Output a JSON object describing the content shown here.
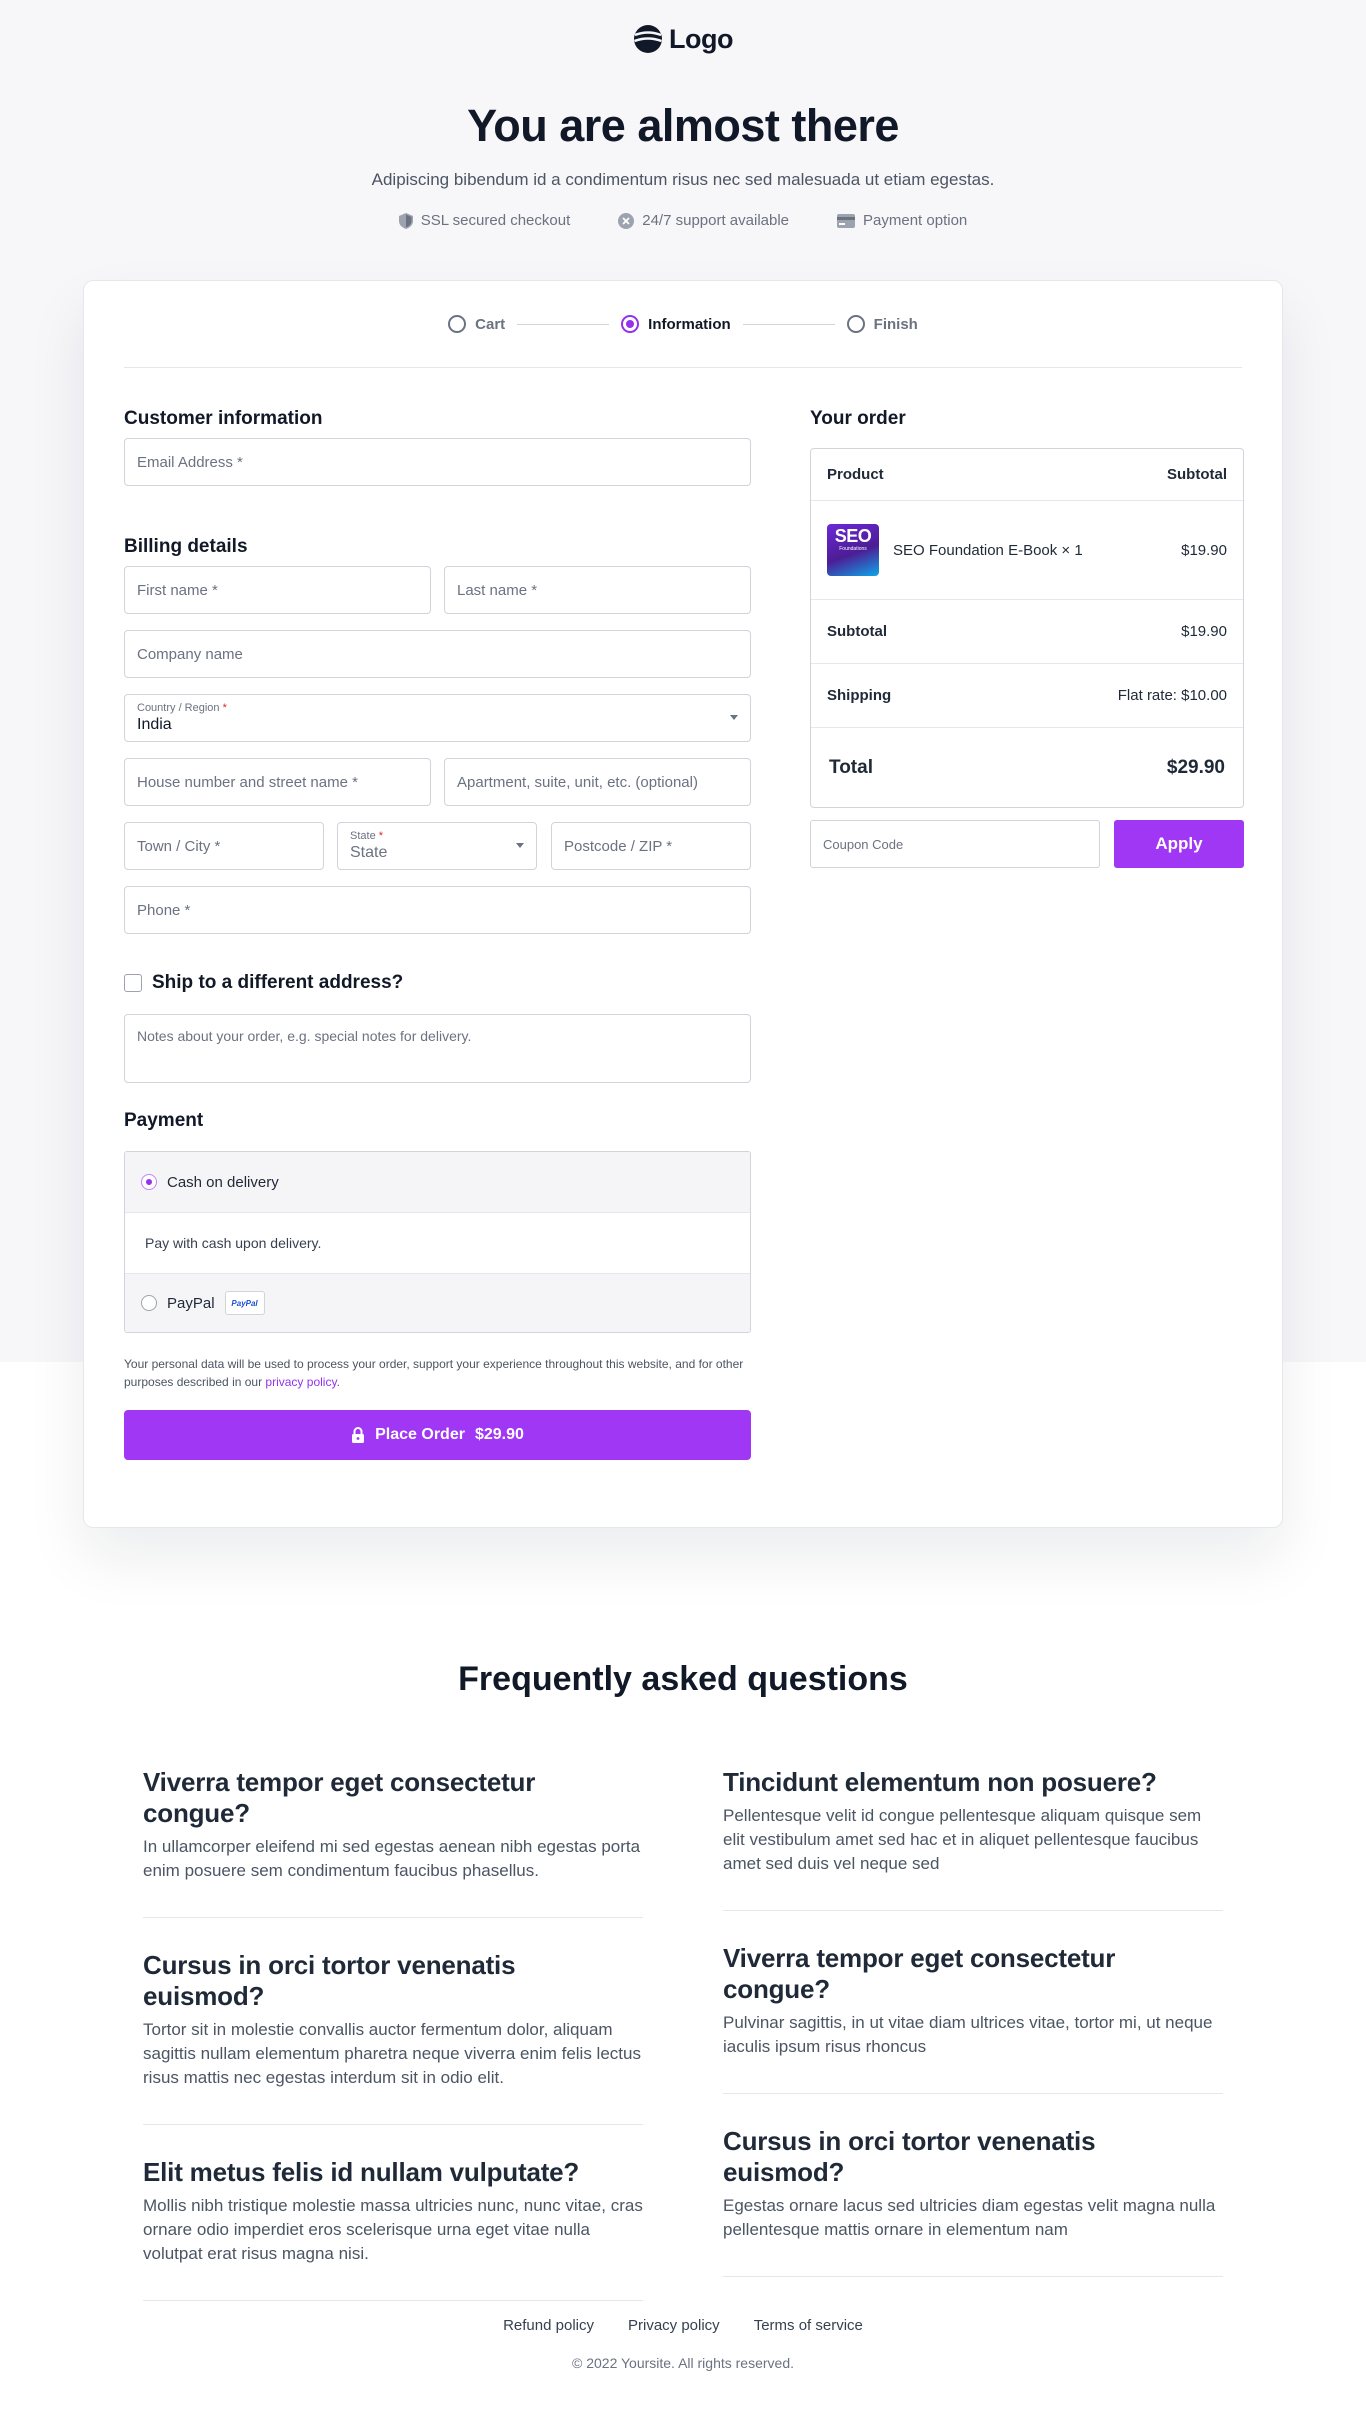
{
  "header": {
    "logo_text": "Logo",
    "title": "You are almost there",
    "subtitle": "Adipiscing bibendum id a condimentum risus nec sed malesuada ut etiam egestas.",
    "trust": [
      {
        "icon": "shield-icon",
        "label": "SSL secured checkout"
      },
      {
        "icon": "support-icon",
        "label": "24/7 support available"
      },
      {
        "icon": "credit-card-icon",
        "label": "Payment option"
      }
    ]
  },
  "steps": [
    {
      "label": "Cart",
      "active": false
    },
    {
      "label": "Information",
      "active": true
    },
    {
      "label": "Finish",
      "active": false
    }
  ],
  "customer": {
    "title": "Customer information",
    "email_placeholder": "Email Address *"
  },
  "billing": {
    "title": "Billing details",
    "first_name": "First name *",
    "last_name": "Last name *",
    "company": "Company name",
    "country_label": "Country / Region",
    "country_value": "India",
    "house": "House number and street name *",
    "apartment": "Apartment, suite, unit, etc. (optional)",
    "town": "Town / City *",
    "state_label": "State",
    "state_value": "State",
    "postcode": "Postcode / ZIP *",
    "phone": "Phone *",
    "required_mark": "*"
  },
  "ship_different": "Ship to a different address?",
  "notes_placeholder": "Notes about your order, e.g. special notes for delivery.",
  "payment": {
    "title": "Payment",
    "cod_label": "Cash on delivery",
    "cod_desc": "Pay with cash upon delivery.",
    "paypal_label": "PayPal",
    "paypal_badge": "PayPal"
  },
  "privacy": {
    "text": "Your personal data will be used to process your order, support your experience throughout this website, and for other purposes described in our ",
    "link": "privacy policy",
    "end": "."
  },
  "place_order": {
    "label": "Place Order",
    "amount": "$29.90"
  },
  "order": {
    "title": "Your order",
    "head_product": "Product",
    "head_subtotal": "Subtotal",
    "product_thumb_title": "SEO",
    "product_thumb_sub": "Foundations",
    "product_name": "SEO Foundation E-Book × 1",
    "product_price": "$19.90",
    "subtotal_label": "Subtotal",
    "subtotal_value": "$19.90",
    "shipping_label": "Shipping",
    "shipping_value": "Flat rate: $10.00",
    "total_label": "Total",
    "total_value": "$29.90",
    "coupon_placeholder": "Coupon Code",
    "apply_label": "Apply"
  },
  "faq": {
    "title": "Frequently asked questions",
    "left": [
      {
        "q": "Viverra tempor eget consectetur congue?",
        "a": "In ullamcorper eleifend mi sed egestas aenean nibh egestas porta enim posuere sem condimentum faucibus phasellus."
      },
      {
        "q": "Cursus in orci tortor venenatis euismod?",
        "a": "Tortor sit in molestie convallis auctor fermentum dolor, aliquam sagittis nullam elementum pharetra neque viverra enim felis lectus risus mattis nec egestas interdum sit in odio elit."
      },
      {
        "q": "Elit metus felis id nullam vulputate?",
        "a": "Mollis nibh tristique molestie massa ultricies nunc, nunc vitae, cras ornare odio imperdiet eros scelerisque urna eget vitae nulla volutpat erat risus magna nisi."
      }
    ],
    "right": [
      {
        "q": "Tincidunt elementum non posuere?",
        "a": "Pellentesque velit id congue pellentesque aliquam quisque sem elit vestibulum amet sed hac et in aliquet pellentesque faucibus amet sed duis vel neque sed"
      },
      {
        "q": "Viverra tempor eget consectetur congue?",
        "a": "Pulvinar sagittis, in ut vitae diam ultrices vitae, tortor mi, ut neque iaculis ipsum risus rhoncus"
      },
      {
        "q": "Cursus in orci tortor venenatis euismod?",
        "a": "Egestas ornare lacus sed ultricies diam egestas velit magna nulla pellentesque mattis ornare in elementum nam"
      }
    ]
  },
  "footer": {
    "links": [
      "Refund policy",
      "Privacy policy",
      "Terms of service"
    ],
    "copyright": "© 2022 Yoursite. All rights reserved."
  },
  "colors": {
    "accent": "#9f37f5",
    "page_bg": "#f7f6f9"
  }
}
